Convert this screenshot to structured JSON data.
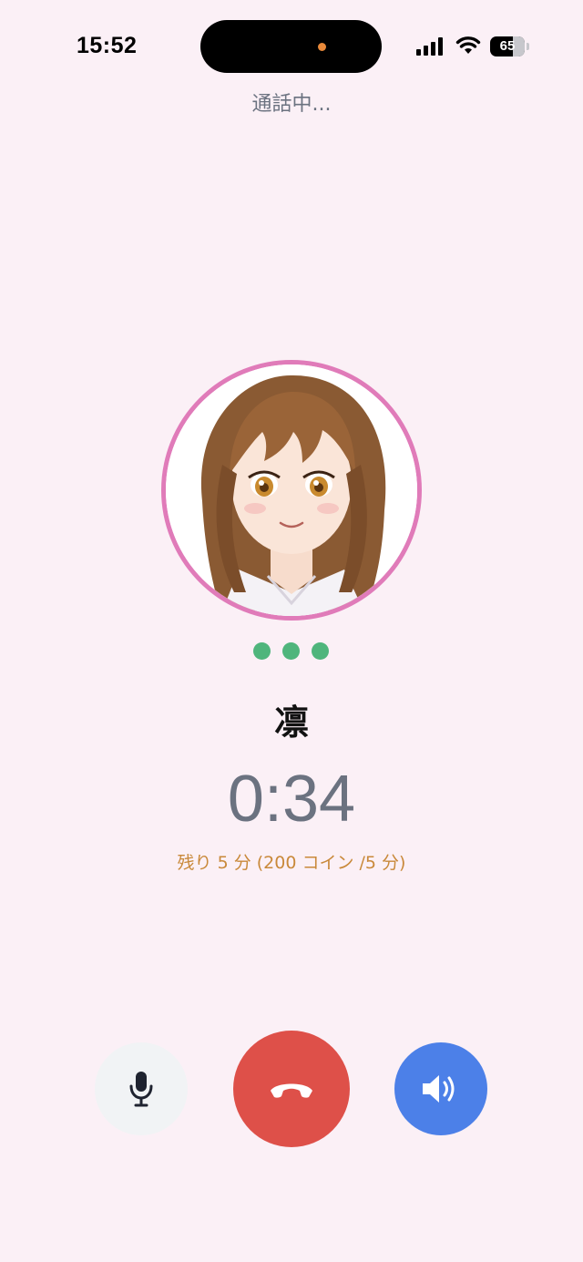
{
  "status_bar": {
    "time": "15:52",
    "battery_level": "65",
    "battery_fraction": 0.65,
    "signal_icon": "cellular-signal-icon",
    "wifi_icon": "wifi-icon"
  },
  "call": {
    "status_text": "通話中...",
    "caller_name": "凛",
    "timer": "0:34",
    "remaining_text": "残り 5 分 (200 コイン /5 分)"
  },
  "controls": {
    "mute_icon": "microphone-icon",
    "end_icon": "phone-hangup-icon",
    "speaker_icon": "speaker-icon"
  },
  "colors": {
    "background": "#fbf0f6",
    "avatar_ring": "#e07bb9",
    "indicator_dots": "#4fb57c",
    "end_call": "#de5049",
    "speaker_active": "#4c80e8",
    "remaining_text": "#c9893a"
  }
}
